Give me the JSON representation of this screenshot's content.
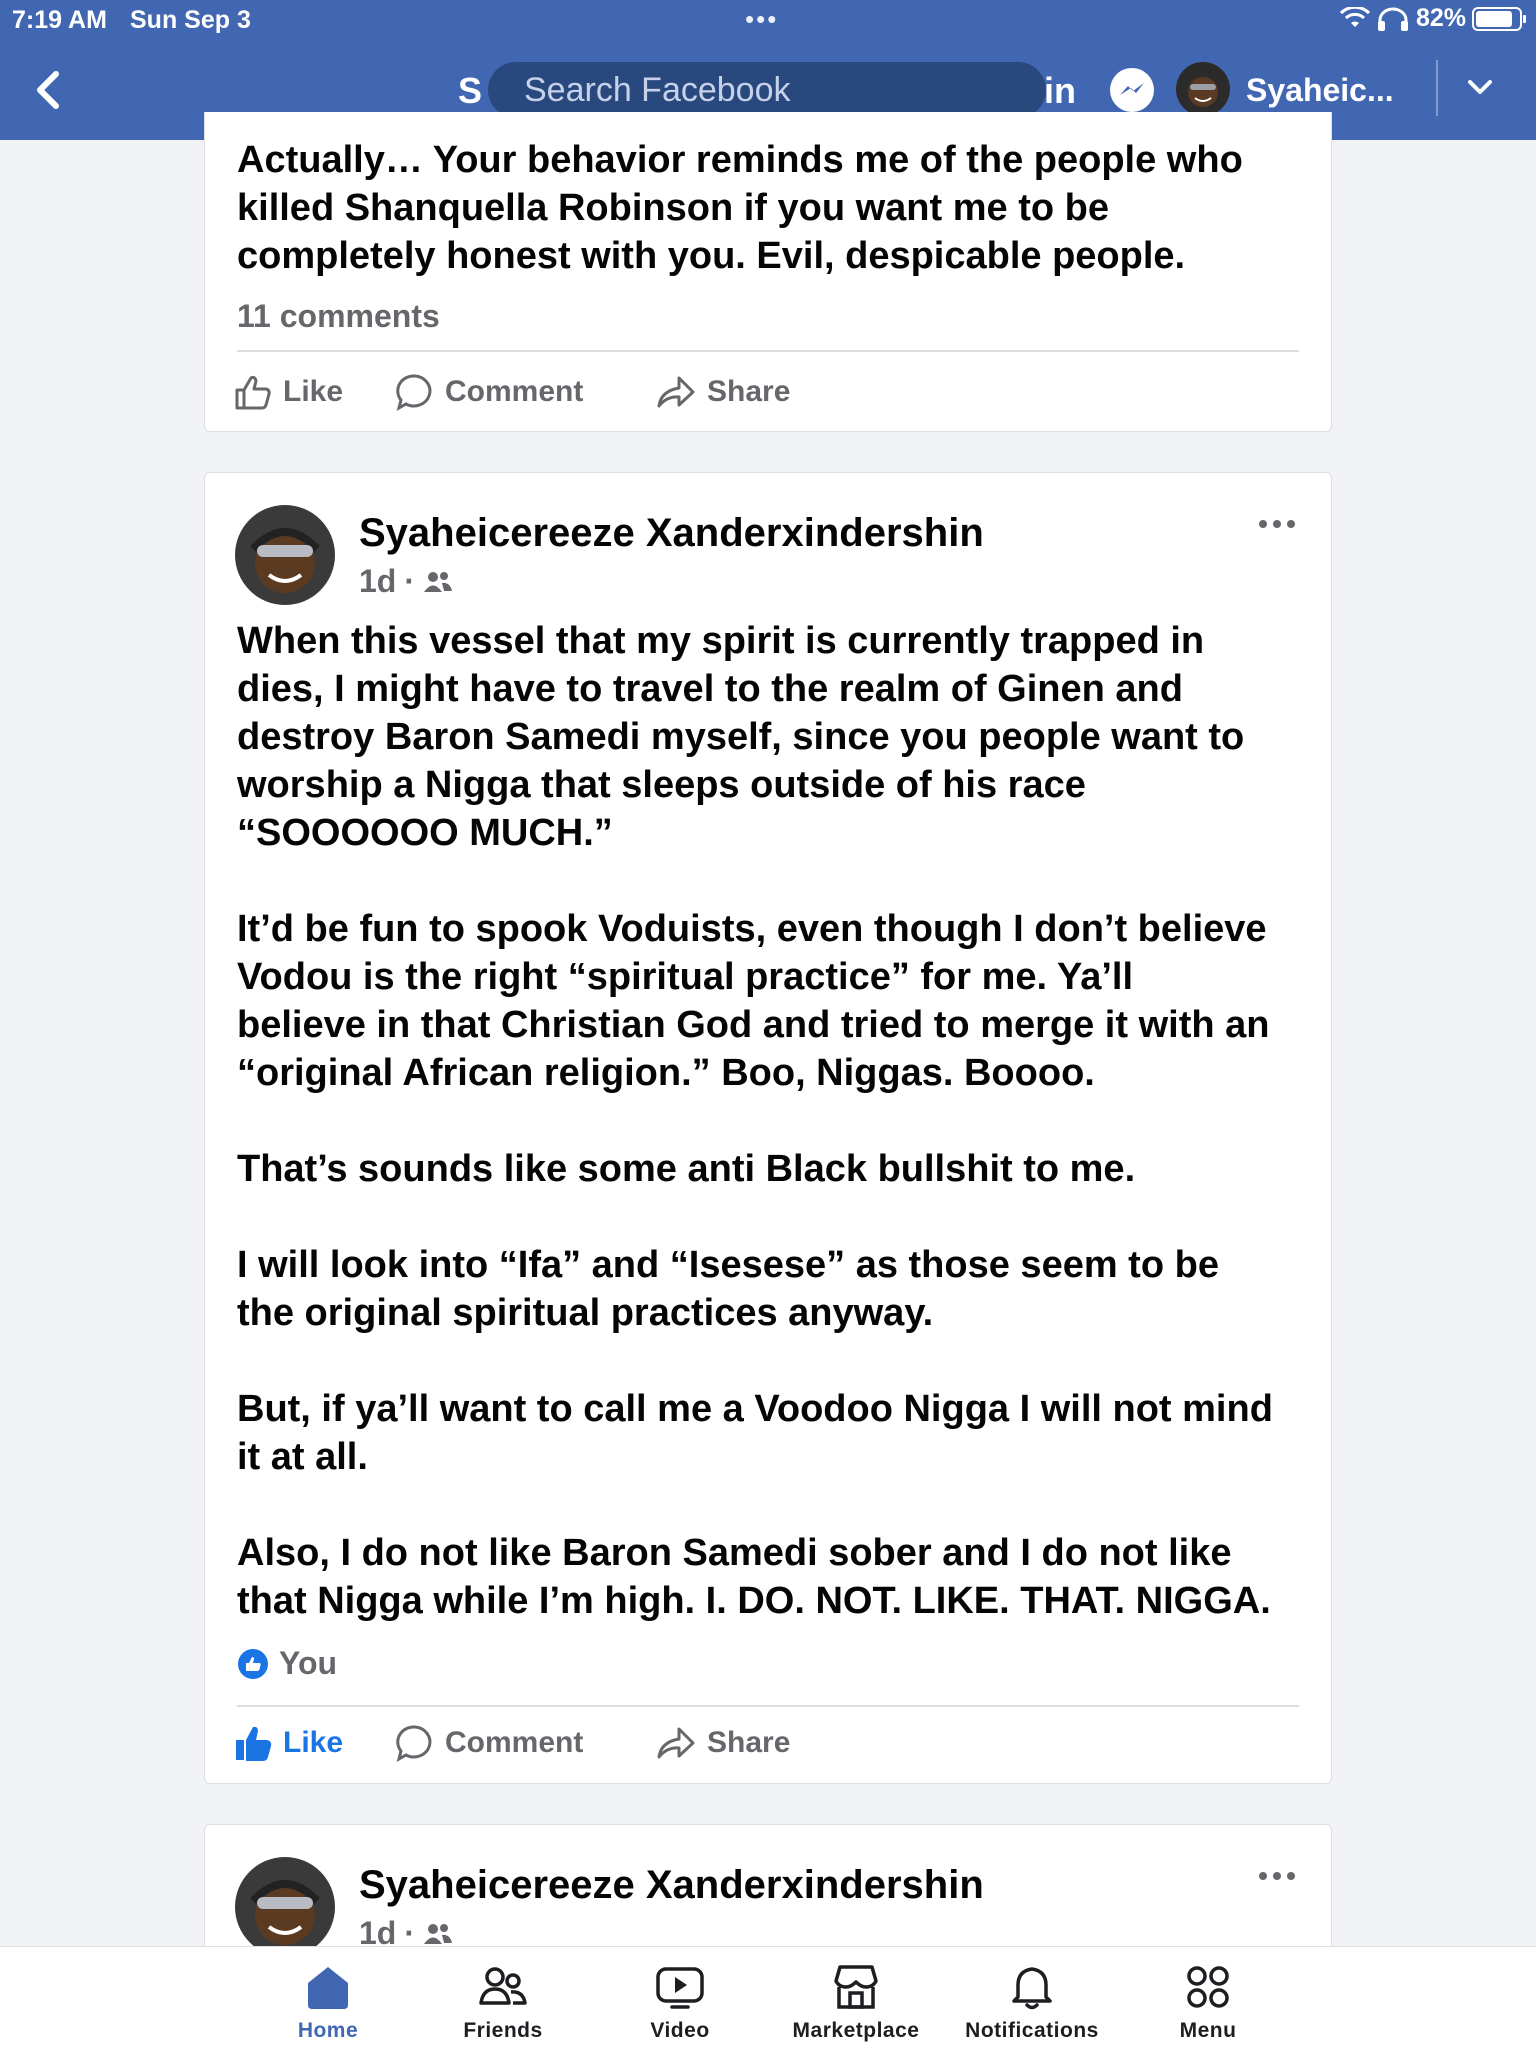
{
  "status_bar": {
    "time": "7:19 AM",
    "date": "Sun Sep 3",
    "battery": "82%"
  },
  "nav": {
    "search_placeholder": "Search Facebook",
    "left_fragment": "S",
    "right_fragment": "in",
    "username": "Syaheic...",
    "icons": [
      "back-chevron-icon",
      "messenger-icon",
      "chevron-down-icon"
    ]
  },
  "posts": [
    {
      "text": "Actually… Your behavior reminds me of the people who\nkilled Shanquella Robinson if you want me to be\ncompletely honest with you. Evil, despicable people.",
      "comments_count": "11 comments",
      "actions": {
        "like": "Like",
        "comment": "Comment",
        "share": "Share"
      }
    },
    {
      "author": "Syaheicereeze Xanderxindershin",
      "time": "1d",
      "audience_icon": "friends-icon",
      "text": "When this vessel that my spirit is currently trapped in\ndies, I might have to travel to the realm of Ginen and\ndestroy Baron Samedi myself, since you people want to\nworship a Nigga that sleeps outside of his race\n“SOOOOOO MUCH.”\n\nIt’d be fun to spook Voduists, even though I don’t believe\nVodou is the right “spiritual practice” for me. Ya’ll\nbelieve in that Christian God and tried to merge it with an\n“original African religion.” Boo, Niggas. Boooo.\n\nThat’s sounds like some anti Black bullshit to me.\n\nI will look into “Ifa” and “Isesese” as those seem to be\nthe original spiritual practices anyway.\n\nBut, if ya’ll want to call me a Voodoo Nigga I will not mind\nit at all.\n\nAlso, I do not like Baron Samedi sober and I do not like\nthat Nigga while I’m high. I. DO. NOT. LIKE. THAT. NIGGA.",
      "reactions": "You",
      "liked": true,
      "actions": {
        "like": "Like",
        "comment": "Comment",
        "share": "Share"
      }
    },
    {
      "author": "Syaheicereeze Xanderxindershin",
      "time": "1d",
      "audience_icon": "friends-icon"
    }
  ],
  "tabs": [
    {
      "label": "Home",
      "icon": "home-icon",
      "active": true
    },
    {
      "label": "Friends",
      "icon": "friends-icon",
      "active": false
    },
    {
      "label": "Video",
      "icon": "video-icon",
      "active": false
    },
    {
      "label": "Marketplace",
      "icon": "marketplace-icon",
      "active": false
    },
    {
      "label": "Notifications",
      "icon": "bell-icon",
      "active": false
    },
    {
      "label": "Menu",
      "icon": "menu-grid-icon",
      "active": false
    }
  ],
  "colors": {
    "brand": "#4267b2",
    "brand_dark": "#29487d",
    "like_active": "#1b74e4",
    "secondary_text": "#65676b",
    "feed_background": "#f0f2f5"
  }
}
